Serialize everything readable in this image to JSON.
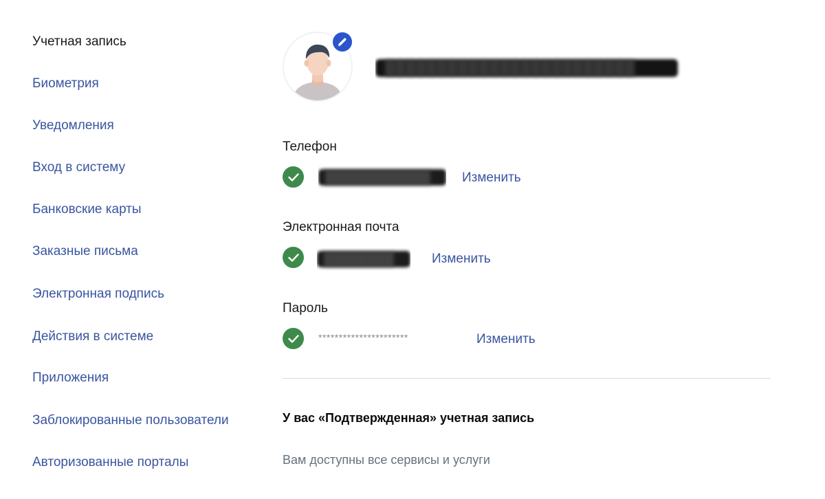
{
  "sidebar": {
    "items": [
      {
        "label": "Учетная запись"
      },
      {
        "label": "Биометрия"
      },
      {
        "label": "Уведомления"
      },
      {
        "label": "Вход в систему"
      },
      {
        "label": "Банковские карты"
      },
      {
        "label": "Заказные письма"
      },
      {
        "label": "Электронная подпись"
      },
      {
        "label": "Действия в системе"
      },
      {
        "label": "Приложения"
      },
      {
        "label": "Заблокированные пользователи"
      },
      {
        "label": "Авторизованные порталы"
      }
    ]
  },
  "profile": {
    "avatar_icon": "user-avatar-icon",
    "edit_icon": "pencil-icon"
  },
  "contacts": {
    "phone": {
      "label": "Телефон",
      "change_label": "Изменить"
    },
    "email": {
      "label": "Электронная почта",
      "change_label": "Изменить"
    },
    "password": {
      "label": "Пароль",
      "mask": "**********************",
      "change_label": "Изменить"
    }
  },
  "account_status": {
    "title": "У вас «Подтвержденная» учетная запись",
    "description": "Вам доступны все сервисы и услуги"
  },
  "colors": {
    "link": "#3a55a0",
    "verified": "#3e8a4b",
    "edit_badge": "#2a55cc",
    "muted_text": "#66727f"
  }
}
